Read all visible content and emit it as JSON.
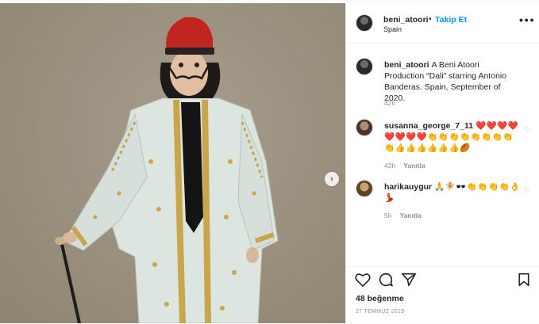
{
  "post": {
    "username": "beni_atoori",
    "follow_label": "Takip Et",
    "dot": "•",
    "location": "Spain",
    "caption": "A Beni Atoori Production “Dali” starring Antonio Banderas. Spain, September of 2020.",
    "caption_time": "42h",
    "likes": "48 beğenme",
    "date": "27 TEMMUZ 2019"
  },
  "comments": [
    {
      "username": "susanna_george_7_11",
      "text": "❤️❤️❤️❤️❤️❤️❤️❤️👏👏👏👏👏👏👏👏👏👍👍👍👍👍👍🏉",
      "time": "42h",
      "reply_label": "Yanıtla"
    },
    {
      "username": "harikauygur",
      "text": "🙏🧚🕶️👏👏👏👏👌💃",
      "time": "5h",
      "reply_label": "Yanıtla"
    }
  ],
  "icons": {
    "like": "heart-icon",
    "comment": "comment-icon",
    "share": "share-icon",
    "save": "bookmark-icon",
    "more": "more-options-icon",
    "next": "chevron-right-icon"
  },
  "colors": {
    "follow_blue": "#0095f6",
    "photo_bg": "#9a8f7d",
    "robe": "#dde5e1",
    "fez": "#c0261f",
    "gold_trim": "#c9a64a"
  }
}
